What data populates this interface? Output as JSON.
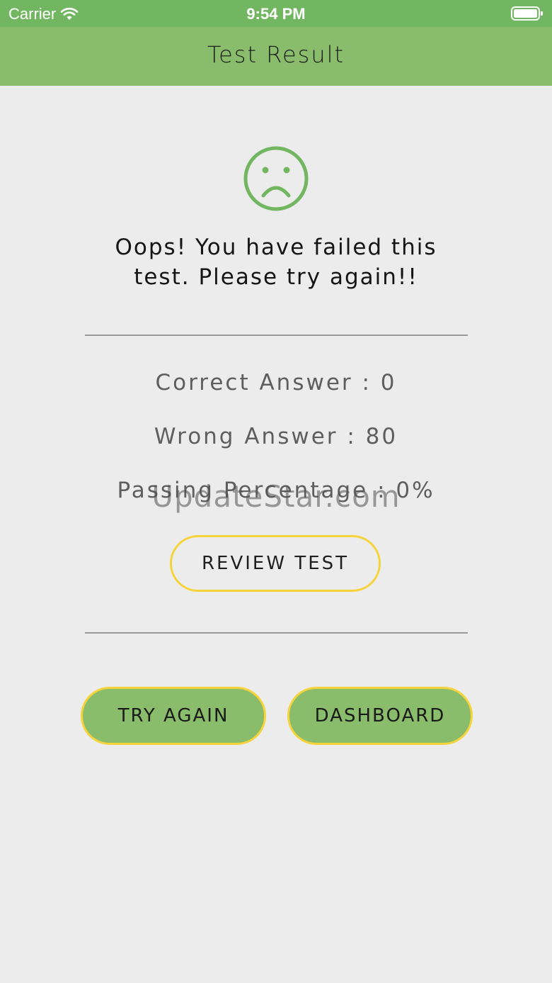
{
  "status_bar": {
    "carrier": "Carrier",
    "time": "9:54 PM"
  },
  "nav": {
    "title": "Test Result"
  },
  "result": {
    "icon": "sad-face-icon",
    "message_line1": "Oops! You have failed this",
    "message_line2": "test. Please try again!!"
  },
  "stats": {
    "correct": "Correct Answer : 0",
    "wrong": "Wrong Answer : 80",
    "passing": "Passing Percentage : 0%"
  },
  "watermark": "UpdateStar.com",
  "buttons": {
    "review": "REVIEW TEST",
    "try_again": "TRY AGAIN",
    "dashboard": "DASHBOARD"
  },
  "colors": {
    "accent_green": "#89bd6b",
    "status_green": "#73b661",
    "button_border": "#f6d33b",
    "background": "#ececec"
  }
}
